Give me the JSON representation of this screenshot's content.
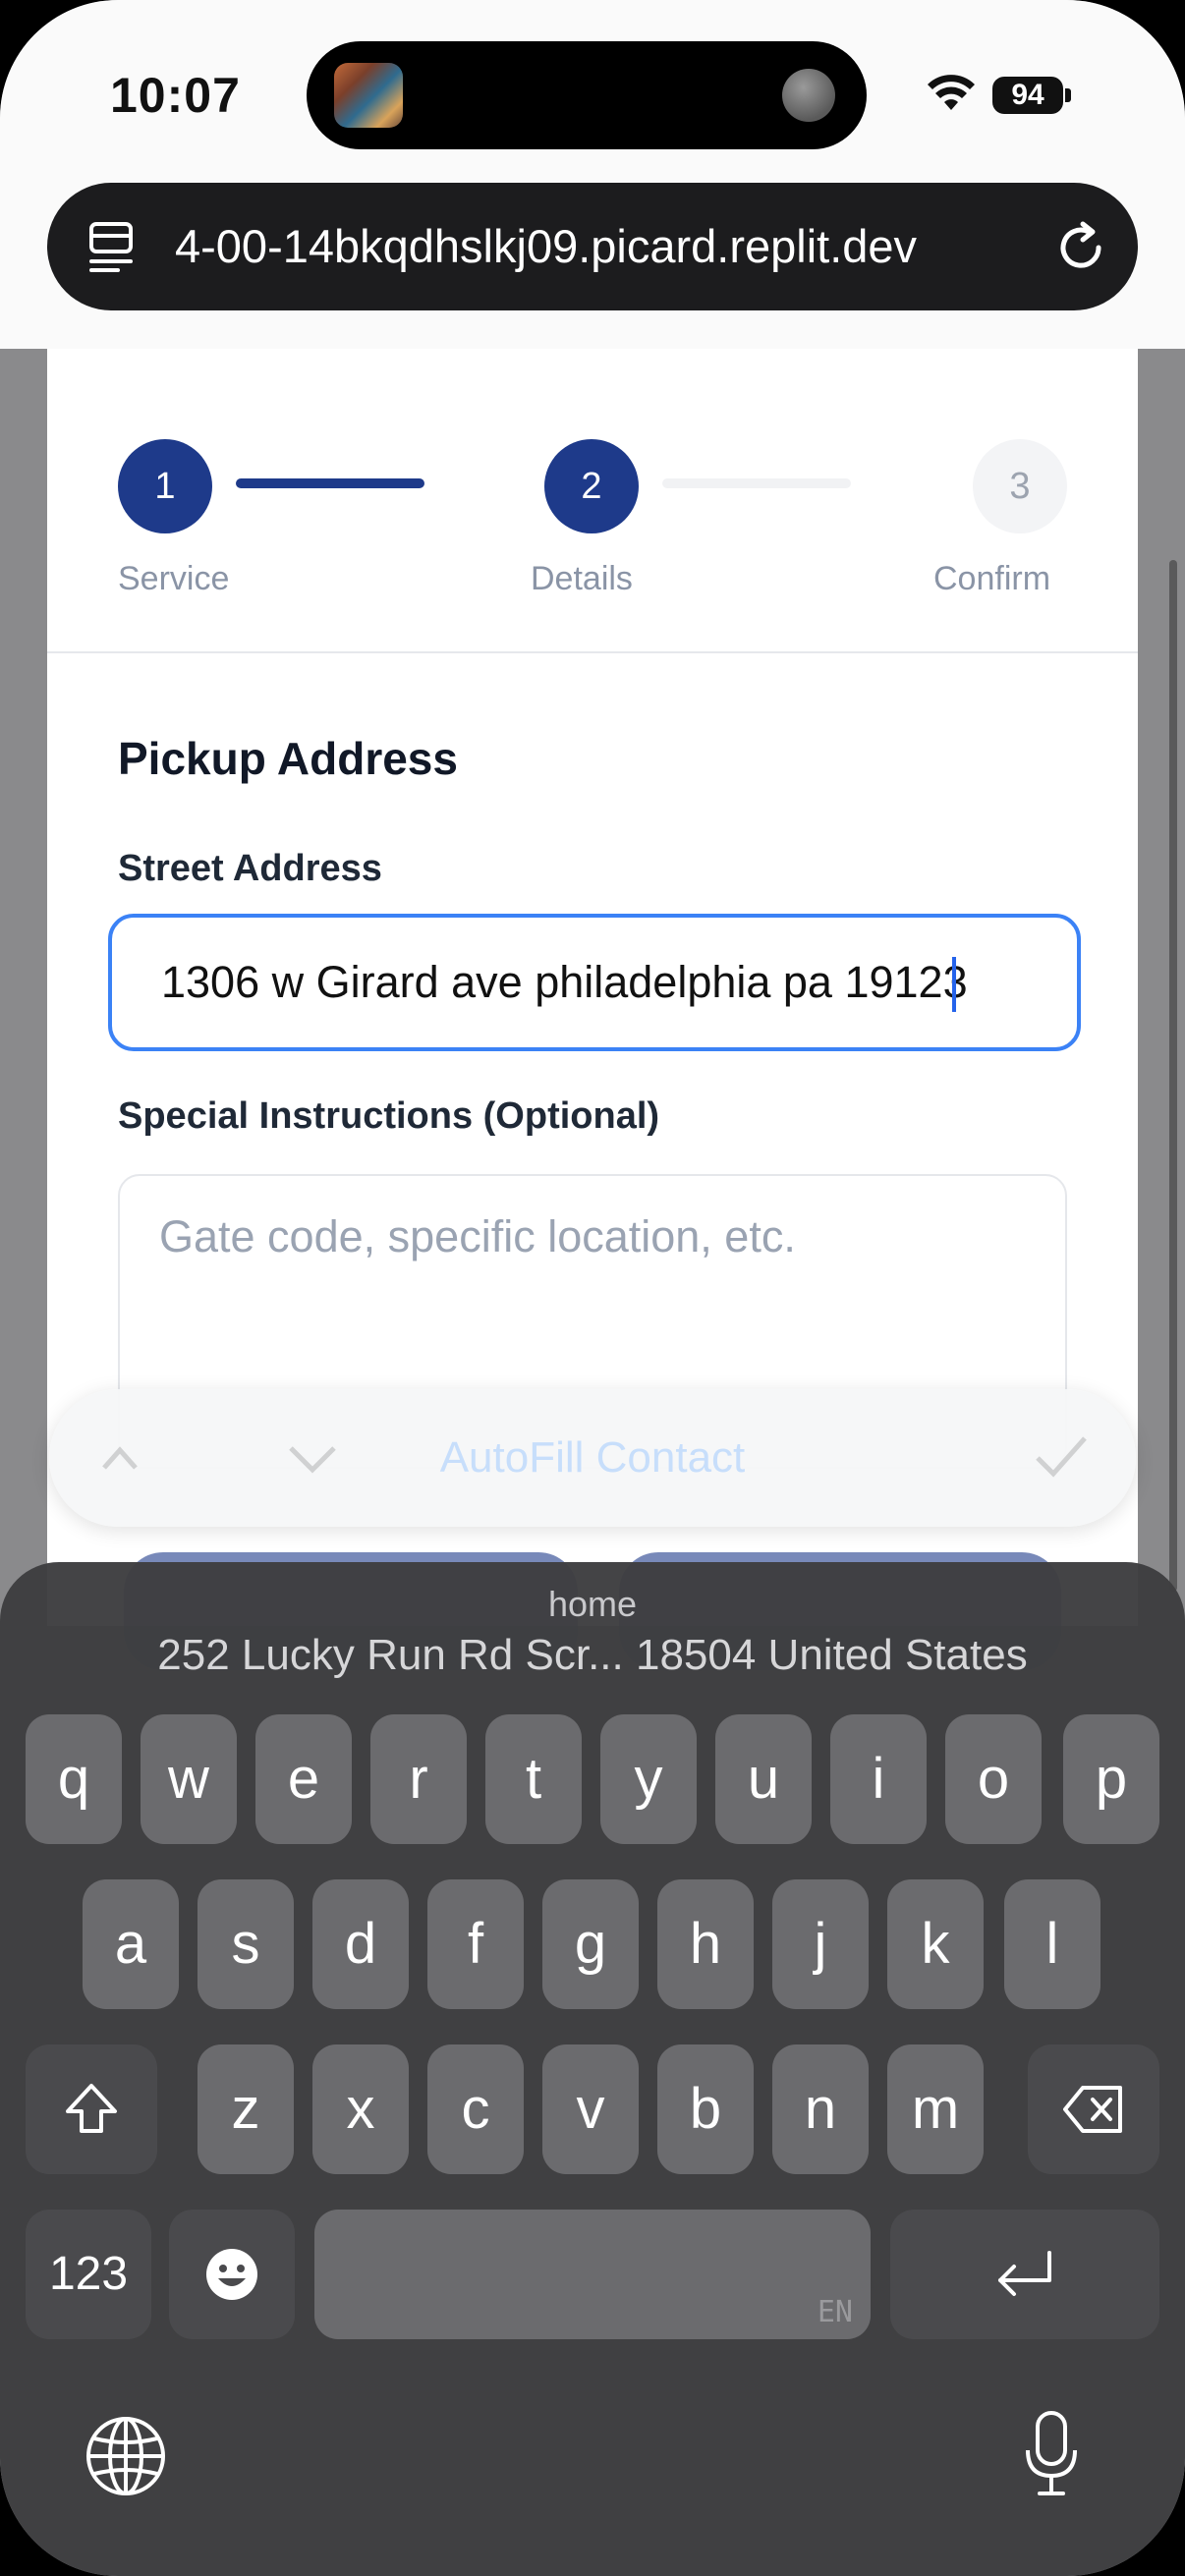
{
  "status_bar": {
    "time": "10:07",
    "battery": "94"
  },
  "browser": {
    "url": "4-00-14bkqdhslkj09.picard.replit.dev"
  },
  "stepper": {
    "steps": [
      {
        "number": "1",
        "label": "Service"
      },
      {
        "number": "2",
        "label": "Details"
      },
      {
        "number": "3",
        "label": "Confirm"
      }
    ],
    "current_step": 2
  },
  "form": {
    "section_title": "Pickup Address",
    "street_label": "Street Address",
    "street_value": "1306 w Girard ave philadelphia pa 19123",
    "instructions_label": "Special Instructions (Optional)",
    "instructions_placeholder": "Gate code, specific location, etc."
  },
  "autofill_bar": {
    "label": "AutoFill Contact"
  },
  "keyboard": {
    "suggestion_label": "home",
    "suggestion_value": "252 Lucky Run Rd Scr... 18504 United States",
    "row1": [
      "q",
      "w",
      "e",
      "r",
      "t",
      "y",
      "u",
      "i",
      "o",
      "p"
    ],
    "row2": [
      "a",
      "s",
      "d",
      "f",
      "g",
      "h",
      "j",
      "k",
      "l"
    ],
    "row3": [
      "z",
      "x",
      "c",
      "v",
      "b",
      "n",
      "m"
    ],
    "numbers_key": "123",
    "space_lang": "EN"
  }
}
